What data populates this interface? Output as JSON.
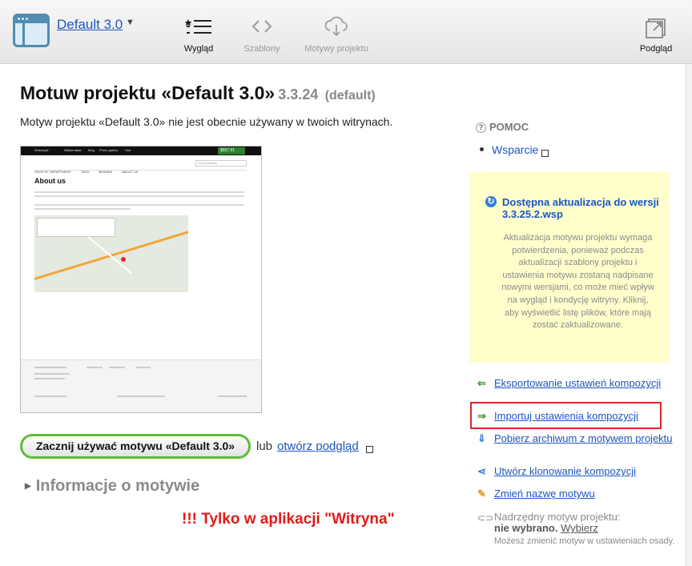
{
  "toolbar": {
    "theme_name": "Default 3.0",
    "tools": [
      {
        "label": "Wygląd",
        "icon": "list-icon",
        "state": "active"
      },
      {
        "label": "Szablony",
        "icon": "code-brackets-icon",
        "state": "disabled"
      },
      {
        "label": "Motywy projektu",
        "icon": "cloud-download-icon",
        "state": "disabled"
      }
    ],
    "preview_label": "Podgląd"
  },
  "main": {
    "title": "Motuw projektu «Default 3.0»",
    "version": "3.3.24",
    "version_tag": "(default)",
    "intro": "Motyw projektu «Default 3.0» nie jest obecnie używany w twoich witrynach.",
    "thumbnail": {
      "heading": "About us",
      "nav_items": [
        "SHOP BY DEPARTMENT",
        "TAGS",
        "BRANDS",
        "ABOUT US"
      ],
      "search_placeholder": "Find products",
      "cart": "$557.91",
      "top_links": [
        "Webasyst",
        "Online store",
        "Blog",
        "Photo gallery",
        "Hub"
      ]
    },
    "start_button": "Zacznij używać motywu «Default 3.0»",
    "or_text": "lub",
    "preview_link": "otwórz podgląd",
    "info_toggle": "Informacje o motywie",
    "warning": "!!! Tylko w aplikacji \"Witryna\""
  },
  "sidebar": {
    "help_title": "POMOC",
    "support_link": "Wsparcie",
    "update": {
      "title": "Dostępna aktualizacja do wersji 3.3.25.2.wsp",
      "body": "Aktualizacja motywu projektu wymaga potwierdzenia, ponieważ podczas aktualizacji szablony projektu i ustawienia motywu zostaną nadpisane nowymi wersjami, co może mieć wpływ na wygląd i kondycję witryny. Kliknij, aby wyświetlić listę plików, które mają zostać zaktualizowane."
    },
    "actions": [
      {
        "label": "Eksportowanie ustawień kompozycji",
        "icon": "arrow-left-icon",
        "color": "#3a9a2b"
      },
      {
        "label": "Importuj ustawienia kompozycji",
        "icon": "arrow-right-icon",
        "color": "#3a9a2b"
      },
      {
        "label": "Pobierz archiwum z motywem projektu",
        "icon": "arrow-down-icon",
        "color": "#2e7fd4"
      },
      {
        "label": "Utwórz klonowanie kompozycji",
        "icon": "share-icon",
        "color": "#2e7fd4"
      },
      {
        "label": "Zmień nazwę motywu",
        "icon": "pencil-icon",
        "color": "#e0a020"
      }
    ],
    "parent": {
      "label": "Nadrzędny motyw projektu:",
      "value": "nie wybrano.",
      "choose": "Wybierz",
      "note": "Możesz zmienić motyw w ustawieniach osady."
    }
  }
}
